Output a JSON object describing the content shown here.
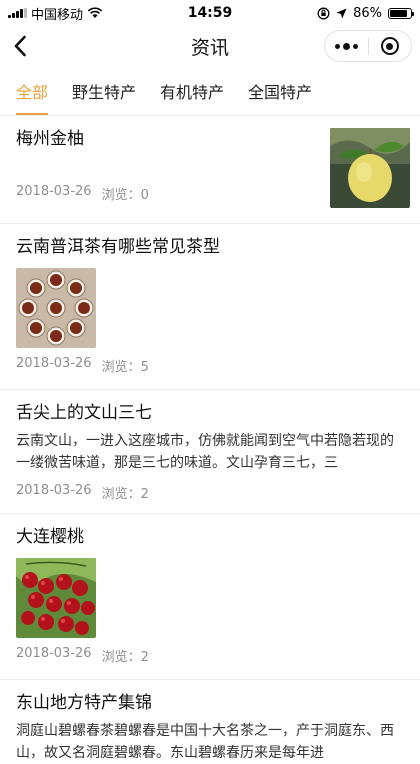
{
  "statusbar": {
    "carrier": "中国移动",
    "time": "14:59",
    "battery": "86%",
    "battery_level": 0.86
  },
  "navbar": {
    "title": "资讯"
  },
  "tabs": [
    {
      "label": "全部"
    },
    {
      "label": "野生特产"
    },
    {
      "label": "有机特产"
    },
    {
      "label": "全国特产"
    }
  ],
  "views_label": "浏览：",
  "articles": [
    {
      "title": "梅州金柚",
      "date": "2018-03-26",
      "views": "0",
      "image": "pomelo"
    },
    {
      "title": "云南普洱茶有哪些常见茶型",
      "date": "2018-03-26",
      "views": "5",
      "image": "tea-cups"
    },
    {
      "title": "舌尖上的文山三七",
      "desc": "云南文山，一进入这座城市，仿佛就能闻到空气中若隐若现的一缕微苦味道，那是三七的味道。文山孕育三七，三",
      "date": "2018-03-26",
      "views": "2"
    },
    {
      "title": "大连樱桃",
      "date": "2018-03-26",
      "views": "2",
      "image": "cherries"
    },
    {
      "title": "东山地方特产集锦",
      "desc": "洞庭山碧螺春茶碧螺春是中国十大名茶之一，产于洞庭东、西山，故又名洞庭碧螺春。东山碧螺春历来是每年进"
    }
  ],
  "colors": {
    "accent": "#e8a33b"
  }
}
